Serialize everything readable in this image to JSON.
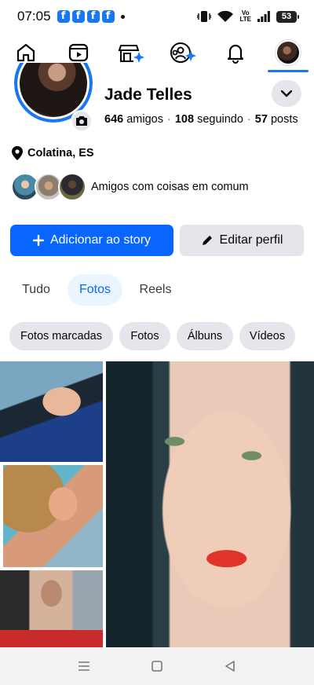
{
  "status_bar": {
    "time": "07:05",
    "fb_badges": [
      "f",
      "f",
      "f",
      "f"
    ],
    "volte_line1": "Vo",
    "volte_line2": "LTE",
    "battery": "53"
  },
  "nav": {
    "items": [
      {
        "name": "home",
        "icon": "home-icon"
      },
      {
        "name": "video",
        "icon": "video-icon"
      },
      {
        "name": "marketplace",
        "icon": "marketplace-icon"
      },
      {
        "name": "groups",
        "icon": "groups-icon"
      },
      {
        "name": "notifications",
        "icon": "bell-icon"
      },
      {
        "name": "profile",
        "icon": "profile-avatar",
        "active": true
      }
    ]
  },
  "profile": {
    "name": "Jade Telles",
    "friends_count": "646",
    "friends_label": "amigos",
    "following_count": "108",
    "following_label": "seguindo",
    "posts_count": "57",
    "posts_label": "posts",
    "location": "Colatina, ES",
    "mutual_text": "Amigos com coisas em comum"
  },
  "actions": {
    "add_story": "Adicionar ao story",
    "edit_profile": "Editar perfil"
  },
  "tabs": [
    {
      "label": "Tudo"
    },
    {
      "label": "Fotos",
      "selected": true
    },
    {
      "label": "Reels"
    }
  ],
  "chips": [
    {
      "label": "Fotos marcadas"
    },
    {
      "label": "Fotos"
    },
    {
      "label": "Álbuns"
    },
    {
      "label": "Vídeos"
    }
  ],
  "colors": {
    "accent": "#0866ff",
    "fb_blue": "#1877f2",
    "chip_bg": "#e4e6eb",
    "selected_tab_bg": "#ebf5ff"
  }
}
